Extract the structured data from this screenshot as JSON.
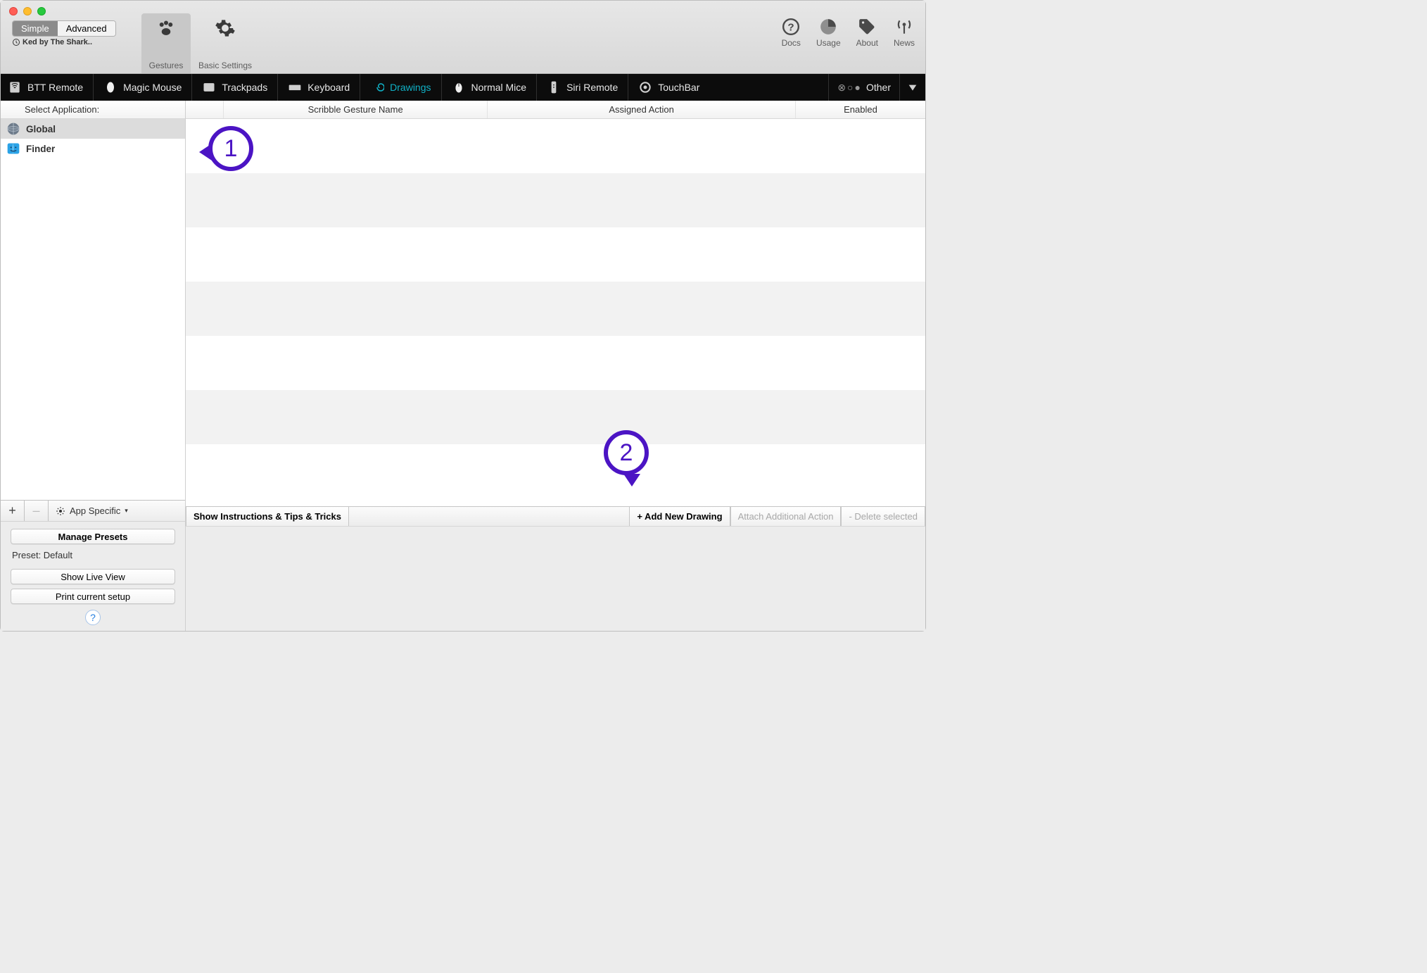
{
  "mode": {
    "simple": "Simple",
    "advanced": "Advanced"
  },
  "preset_marquee": "Ked by The Shark..",
  "toolbar_tabs": {
    "gestures": "Gestures",
    "basic": "Basic Settings"
  },
  "top_right": {
    "docs": "Docs",
    "usage": "Usage",
    "about": "About",
    "news": "News"
  },
  "devices": {
    "btt": "BTT Remote",
    "magic": "Magic Mouse",
    "trackpads": "Trackpads",
    "keyboard": "Keyboard",
    "drawings": "Drawings",
    "mice": "Normal Mice",
    "siri": "Siri Remote",
    "touchbar": "TouchBar",
    "other": "Other"
  },
  "sidebar": {
    "header": "Select Application:",
    "apps": {
      "global": "Global",
      "finder": "Finder"
    },
    "add": "+",
    "remove": "–",
    "app_specific": "App Specific",
    "manage": "Manage Presets",
    "preset_label": "Preset: Default",
    "live_view": "Show Live View",
    "print": "Print current setup",
    "help": "?"
  },
  "columns": {
    "gesture": "Scribble Gesture Name",
    "action": "Assigned Action",
    "enabled": "Enabled"
  },
  "footer": {
    "tips": "Show Instructions & Tips & Tricks",
    "add": "+ Add New Drawing",
    "attach": "Attach Additional Action",
    "delete": "- Delete selected"
  },
  "annotations": {
    "one": "1",
    "two": "2"
  }
}
